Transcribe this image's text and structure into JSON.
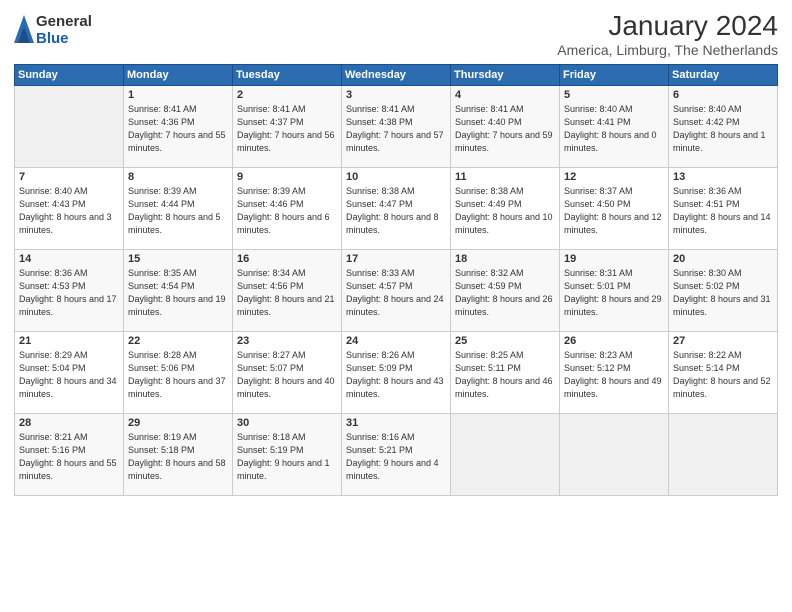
{
  "logo": {
    "general": "General",
    "blue": "Blue"
  },
  "header": {
    "month": "January 2024",
    "location": "America, Limburg, The Netherlands"
  },
  "weekdays": [
    "Sunday",
    "Monday",
    "Tuesday",
    "Wednesday",
    "Thursday",
    "Friday",
    "Saturday"
  ],
  "weeks": [
    [
      {
        "day": "",
        "empty": true
      },
      {
        "day": "1",
        "sunrise": "8:41 AM",
        "sunset": "4:36 PM",
        "daylight": "7 hours and 55 minutes."
      },
      {
        "day": "2",
        "sunrise": "8:41 AM",
        "sunset": "4:37 PM",
        "daylight": "7 hours and 56 minutes."
      },
      {
        "day": "3",
        "sunrise": "8:41 AM",
        "sunset": "4:38 PM",
        "daylight": "7 hours and 57 minutes."
      },
      {
        "day": "4",
        "sunrise": "8:41 AM",
        "sunset": "4:40 PM",
        "daylight": "7 hours and 59 minutes."
      },
      {
        "day": "5",
        "sunrise": "8:40 AM",
        "sunset": "4:41 PM",
        "daylight": "8 hours and 0 minutes."
      },
      {
        "day": "6",
        "sunrise": "8:40 AM",
        "sunset": "4:42 PM",
        "daylight": "8 hours and 1 minute."
      }
    ],
    [
      {
        "day": "7",
        "sunrise": "8:40 AM",
        "sunset": "4:43 PM",
        "daylight": "8 hours and 3 minutes."
      },
      {
        "day": "8",
        "sunrise": "8:39 AM",
        "sunset": "4:44 PM",
        "daylight": "8 hours and 5 minutes."
      },
      {
        "day": "9",
        "sunrise": "8:39 AM",
        "sunset": "4:46 PM",
        "daylight": "8 hours and 6 minutes."
      },
      {
        "day": "10",
        "sunrise": "8:38 AM",
        "sunset": "4:47 PM",
        "daylight": "8 hours and 8 minutes."
      },
      {
        "day": "11",
        "sunrise": "8:38 AM",
        "sunset": "4:49 PM",
        "daylight": "8 hours and 10 minutes."
      },
      {
        "day": "12",
        "sunrise": "8:37 AM",
        "sunset": "4:50 PM",
        "daylight": "8 hours and 12 minutes."
      },
      {
        "day": "13",
        "sunrise": "8:36 AM",
        "sunset": "4:51 PM",
        "daylight": "8 hours and 14 minutes."
      }
    ],
    [
      {
        "day": "14",
        "sunrise": "8:36 AM",
        "sunset": "4:53 PM",
        "daylight": "8 hours and 17 minutes."
      },
      {
        "day": "15",
        "sunrise": "8:35 AM",
        "sunset": "4:54 PM",
        "daylight": "8 hours and 19 minutes."
      },
      {
        "day": "16",
        "sunrise": "8:34 AM",
        "sunset": "4:56 PM",
        "daylight": "8 hours and 21 minutes."
      },
      {
        "day": "17",
        "sunrise": "8:33 AM",
        "sunset": "4:57 PM",
        "daylight": "8 hours and 24 minutes."
      },
      {
        "day": "18",
        "sunrise": "8:32 AM",
        "sunset": "4:59 PM",
        "daylight": "8 hours and 26 minutes."
      },
      {
        "day": "19",
        "sunrise": "8:31 AM",
        "sunset": "5:01 PM",
        "daylight": "8 hours and 29 minutes."
      },
      {
        "day": "20",
        "sunrise": "8:30 AM",
        "sunset": "5:02 PM",
        "daylight": "8 hours and 31 minutes."
      }
    ],
    [
      {
        "day": "21",
        "sunrise": "8:29 AM",
        "sunset": "5:04 PM",
        "daylight": "8 hours and 34 minutes."
      },
      {
        "day": "22",
        "sunrise": "8:28 AM",
        "sunset": "5:06 PM",
        "daylight": "8 hours and 37 minutes."
      },
      {
        "day": "23",
        "sunrise": "8:27 AM",
        "sunset": "5:07 PM",
        "daylight": "8 hours and 40 minutes."
      },
      {
        "day": "24",
        "sunrise": "8:26 AM",
        "sunset": "5:09 PM",
        "daylight": "8 hours and 43 minutes."
      },
      {
        "day": "25",
        "sunrise": "8:25 AM",
        "sunset": "5:11 PM",
        "daylight": "8 hours and 46 minutes."
      },
      {
        "day": "26",
        "sunrise": "8:23 AM",
        "sunset": "5:12 PM",
        "daylight": "8 hours and 49 minutes."
      },
      {
        "day": "27",
        "sunrise": "8:22 AM",
        "sunset": "5:14 PM",
        "daylight": "8 hours and 52 minutes."
      }
    ],
    [
      {
        "day": "28",
        "sunrise": "8:21 AM",
        "sunset": "5:16 PM",
        "daylight": "8 hours and 55 minutes."
      },
      {
        "day": "29",
        "sunrise": "8:19 AM",
        "sunset": "5:18 PM",
        "daylight": "8 hours and 58 minutes."
      },
      {
        "day": "30",
        "sunrise": "8:18 AM",
        "sunset": "5:19 PM",
        "daylight": "9 hours and 1 minute."
      },
      {
        "day": "31",
        "sunrise": "8:16 AM",
        "sunset": "5:21 PM",
        "daylight": "9 hours and 4 minutes."
      },
      {
        "day": "",
        "empty": true
      },
      {
        "day": "",
        "empty": true
      },
      {
        "day": "",
        "empty": true
      }
    ]
  ],
  "labels": {
    "sunrise": "Sunrise:",
    "sunset": "Sunset:",
    "daylight": "Daylight:"
  }
}
